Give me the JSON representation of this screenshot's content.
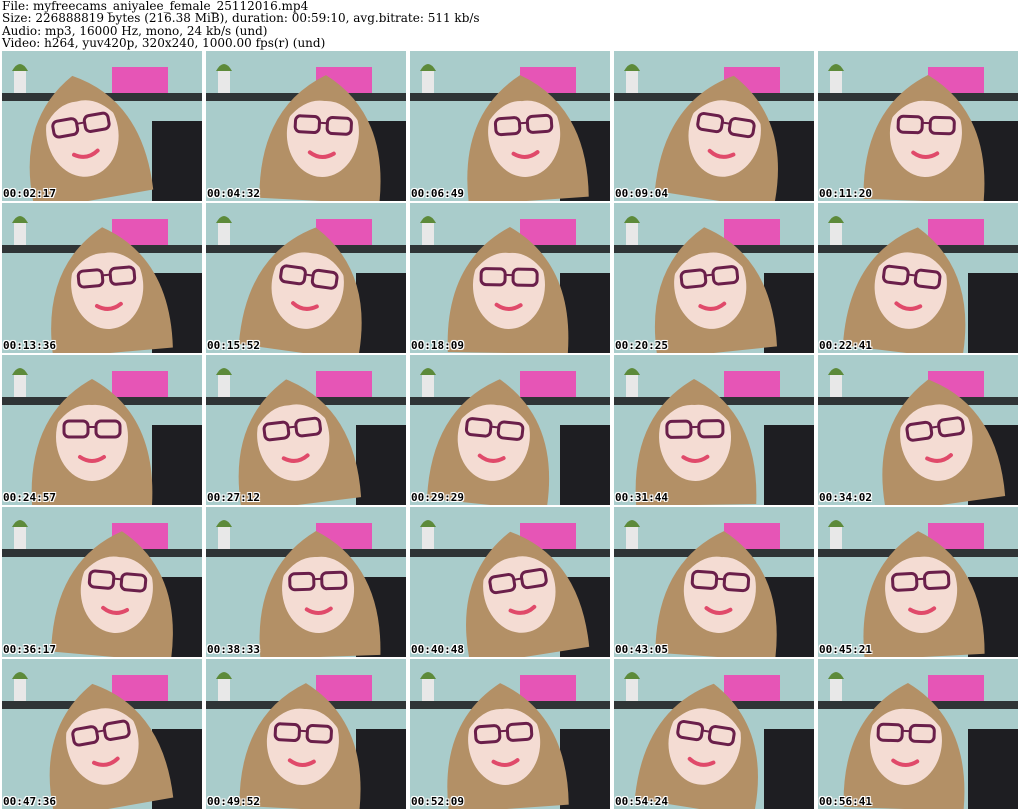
{
  "header": {
    "file_line": "File: myfreecams_aniyalee_female_25112016.mp4",
    "size_line": "Size: 226888819 bytes (216.38 MiB), duration: 00:59:10, avg.bitrate: 511 kb/s",
    "audio_line": "Audio: mp3, 16000 Hz, mono, 24 kb/s (und)",
    "video_line": "Video: h264, yuv420p, 320x240, 1000.00 fps(r) (und)"
  },
  "thumbnails": [
    {
      "timestamp": "00:02:17"
    },
    {
      "timestamp": "00:04:32"
    },
    {
      "timestamp": "00:06:49"
    },
    {
      "timestamp": "00:09:04"
    },
    {
      "timestamp": "00:11:20"
    },
    {
      "timestamp": "00:13:36"
    },
    {
      "timestamp": "00:15:52"
    },
    {
      "timestamp": "00:18:09"
    },
    {
      "timestamp": "00:20:25"
    },
    {
      "timestamp": "00:22:41"
    },
    {
      "timestamp": "00:24:57"
    },
    {
      "timestamp": "00:27:12"
    },
    {
      "timestamp": "00:29:29"
    },
    {
      "timestamp": "00:31:44"
    },
    {
      "timestamp": "00:34:02"
    },
    {
      "timestamp": "00:36:17"
    },
    {
      "timestamp": "00:38:33"
    },
    {
      "timestamp": "00:40:48"
    },
    {
      "timestamp": "00:43:05"
    },
    {
      "timestamp": "00:45:21"
    },
    {
      "timestamp": "00:47:36"
    },
    {
      "timestamp": "00:49:52"
    },
    {
      "timestamp": "00:52:09"
    },
    {
      "timestamp": "00:54:24"
    },
    {
      "timestamp": "00:56:41"
    }
  ],
  "colors": {
    "wall": "#a9cccb",
    "shelf": "#2f3436",
    "box": "#e655b6",
    "hair": "#b39066",
    "skin": "#f4dcd3",
    "glasses": "#6a1f4a",
    "chair": "#1e1e22",
    "lips": "#e04a6a"
  }
}
